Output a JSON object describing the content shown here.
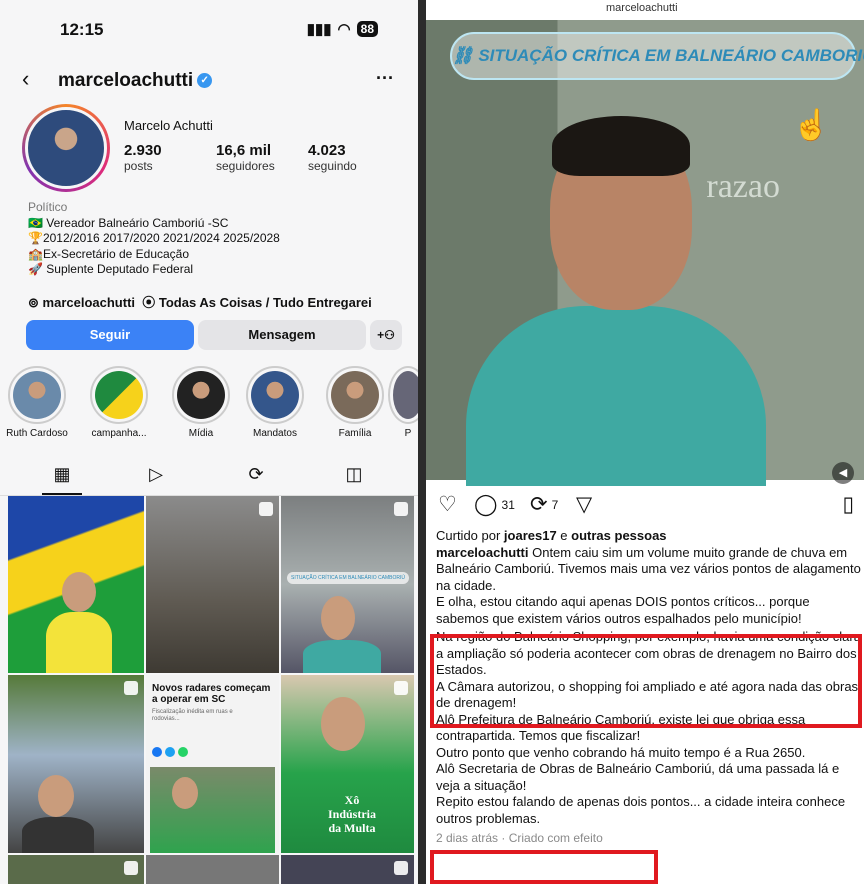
{
  "status": {
    "time": "12:15",
    "battery": "88"
  },
  "profile": {
    "username": "marceloachutti",
    "name": "Marcelo Achutti",
    "posts_n": "2.930",
    "posts_l": "posts",
    "followers_n": "16,6 mil",
    "followers_l": "seguidores",
    "following_n": "4.023",
    "following_l": "seguindo",
    "category": "Político",
    "bio1": "🇧🇷 Vereador Balneário Camboriú -SC",
    "bio2": "🏆2012/2016 2017/2020 2021/2024 2025/2028",
    "bio3": "🏫Ex-Secretário de Educação",
    "bio4": "🚀 Suplente Deputado Federal",
    "threads": "marceloachutti",
    "music": "Todas As Coisas / Tudo Entregarei",
    "follow": "Seguir",
    "message": "Mensagem"
  },
  "highlights": [
    "Ruth Cardoso",
    "campanha...",
    "Mídia",
    "Mandatos",
    "Família",
    "P"
  ],
  "grid": {
    "news_title": "Novos radares começam a operar em SC",
    "news_sub": "Fiscalização inédita em ruas e rodovias...",
    "tile_caption": "SITUAÇÃO CRÍTICA EM BALNEÁRIO CAMBORIÚ",
    "xo": "Xô",
    "industria": "Indústria",
    "da_multa": "da Multa"
  },
  "post": {
    "top_user": "marceloachutti",
    "caption": "SITUAÇÃO CRÍTICA EM BALNEÁRIO CAMBORIÚ",
    "logo": "razao",
    "comments": "31",
    "reposts": "7",
    "liked_pre": "Curtido por ",
    "liked_user": "joares17",
    "liked_mid": " e ",
    "liked_others": "outras pessoas",
    "author": "marceloachutti",
    "p1": " Ontem caiu sim um volume muito grande de chuva em Balneário Camboriú. Tivemos mais uma vez vários pontos de alagamento na cidade.",
    "p2": "E olha, estou citando aqui apenas DOIS pontos críticos... porque sabemos que existem vários outros espalhados pelo município!",
    "p3": "Na região do Balneário Shopping, por exemplo, havia uma condição clara a ampliação só poderia acontecer com obras de drenagem no Bairro dos Estados.",
    "p4": "A Câmara autorizou, o shopping foi ampliado e até agora nada das obras de drenagem!",
    "p5": "Alô Prefeitura de Balneário Camboriú, existe lei que obriga essa contrapartida. Temos que fiscalizar!",
    "p6": "Outro ponto que venho cobrando há muito tempo é a Rua 2650.",
    "p7": "Alô Secretaria de Obras de Balneário Camboriú, dá uma passada lá e veja a situação!",
    "p8": "Repito estou falando de apenas dois pontos... a cidade inteira conhece outros problemas.",
    "footer": "2 dias atrás · Criado com efeito"
  },
  "colors": {
    "follow": "#3b82f6",
    "highlight": "#e0191f",
    "verified": "#3897f0"
  }
}
